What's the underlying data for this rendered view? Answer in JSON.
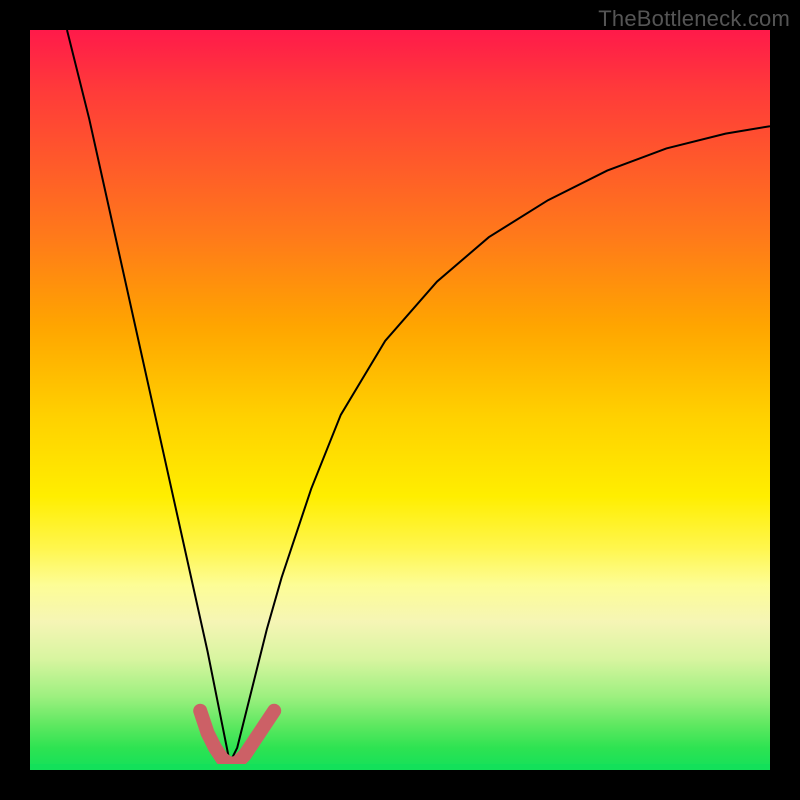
{
  "watermark": "TheBottleneck.com",
  "colors": {
    "background": "#000000",
    "gradient_top": "#ff1a4a",
    "gradient_bottom": "#13e05a",
    "curve": "#000000",
    "highlight": "#cc6066"
  },
  "chart_data": {
    "type": "line",
    "title": "",
    "xlabel": "",
    "ylabel": "",
    "xlim": [
      0,
      100
    ],
    "ylim": [
      0,
      100
    ],
    "notes": "V-shaped bottleneck curve: high at both ends, minimum near x≈27. Thick highlighted segment near the trough (x≈23–33, y≈0–8). No axis ticks, labels, grid, or legend visible.",
    "series": [
      {
        "name": "curve",
        "x": [
          5,
          8,
          10,
          12,
          14,
          16,
          18,
          20,
          22,
          24,
          26,
          27,
          28,
          30,
          32,
          34,
          38,
          42,
          48,
          55,
          62,
          70,
          78,
          86,
          94,
          100
        ],
        "values": [
          100,
          88,
          79,
          70,
          61,
          52,
          43,
          34,
          25,
          16,
          6,
          1,
          3,
          11,
          19,
          26,
          38,
          48,
          58,
          66,
          72,
          77,
          81,
          84,
          86,
          87
        ]
      },
      {
        "name": "highlight",
        "x": [
          23,
          24,
          25,
          26,
          27,
          28,
          29,
          30,
          31,
          32,
          33
        ],
        "values": [
          8,
          5,
          3,
          1.5,
          0.8,
          1,
          2,
          3.5,
          5,
          6.5,
          8
        ]
      }
    ]
  }
}
